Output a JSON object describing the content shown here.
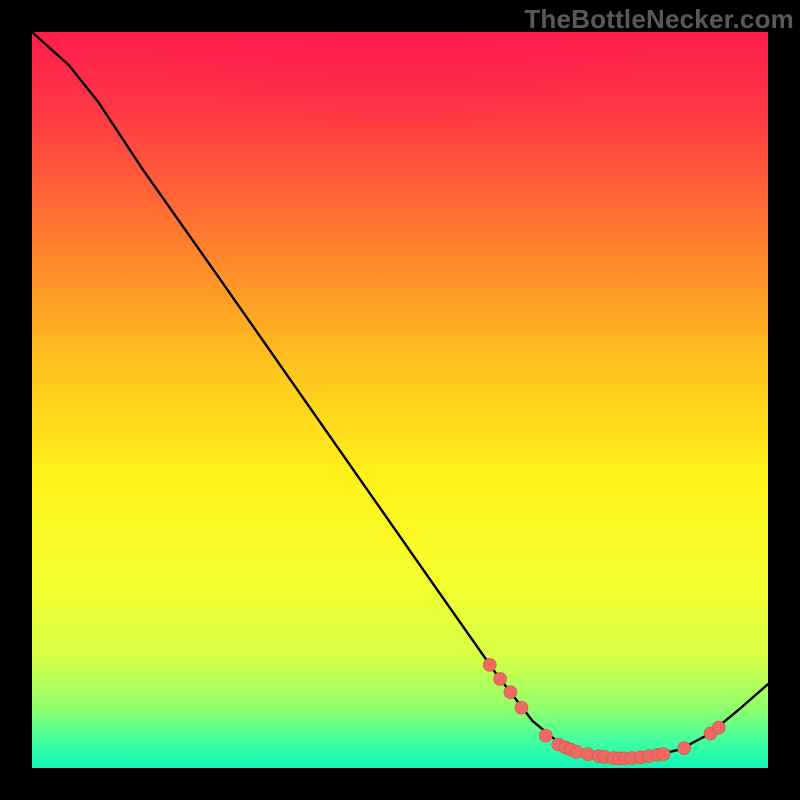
{
  "watermark": "TheBottleNecker.com",
  "colors": {
    "background": "#000000",
    "curve": "#000000",
    "marker_fill": "#ee6a63",
    "marker_stroke": "#d94e47",
    "top_glow": "#ff1a4d"
  },
  "chart_data": {
    "type": "line",
    "title": "",
    "xlabel": "",
    "ylabel": "",
    "xlim": [
      0,
      100
    ],
    "ylim": [
      0,
      100
    ],
    "gradient_stops": [
      {
        "offset": 0.0,
        "color": "#ff1c4e"
      },
      {
        "offset": 0.12,
        "color": "#ff3c43"
      },
      {
        "offset": 0.28,
        "color": "#ff7b2e"
      },
      {
        "offset": 0.45,
        "color": "#ffc21e"
      },
      {
        "offset": 0.6,
        "color": "#fff11a"
      },
      {
        "offset": 0.75,
        "color": "#f4ff2e"
      },
      {
        "offset": 0.85,
        "color": "#d6ff46"
      },
      {
        "offset": 0.92,
        "color": "#8dff6e"
      },
      {
        "offset": 0.965,
        "color": "#3fffa0"
      },
      {
        "offset": 1.0,
        "color": "#10f5b8"
      }
    ],
    "curve_points": [
      [
        0,
        100
      ],
      [
        5,
        95.5
      ],
      [
        9,
        90.5
      ],
      [
        15,
        81.4
      ],
      [
        25,
        67.2
      ],
      [
        35,
        52.9
      ],
      [
        45,
        38.6
      ],
      [
        55,
        24.3
      ],
      [
        63,
        12.9
      ],
      [
        68,
        6.4
      ],
      [
        72,
        3.1
      ],
      [
        76,
        1.6
      ],
      [
        80,
        1.3
      ],
      [
        84,
        1.6
      ],
      [
        88,
        2.5
      ],
      [
        92,
        4.6
      ],
      [
        96,
        7.9
      ],
      [
        100,
        11.4
      ]
    ],
    "markers": [
      [
        62.2,
        14
      ],
      [
        63.6,
        12.1
      ],
      [
        65,
        10.3
      ],
      [
        66.5,
        8.2
      ],
      [
        69.8,
        4.4
      ],
      [
        71.5,
        3.2
      ],
      [
        72.5,
        2.8
      ],
      [
        73.2,
        2.5
      ],
      [
        74,
        2.2
      ],
      [
        75.5,
        1.9
      ],
      [
        77,
        1.6
      ],
      [
        77.8,
        1.5
      ],
      [
        79,
        1.35
      ],
      [
        79.8,
        1.3
      ],
      [
        80.5,
        1.3
      ],
      [
        81.5,
        1.35
      ],
      [
        82.7,
        1.45
      ],
      [
        83.8,
        1.6
      ],
      [
        85,
        1.8
      ],
      [
        85.8,
        1.9
      ],
      [
        88.6,
        2.7
      ],
      [
        92.2,
        4.7
      ],
      [
        93.3,
        5.5
      ]
    ]
  }
}
